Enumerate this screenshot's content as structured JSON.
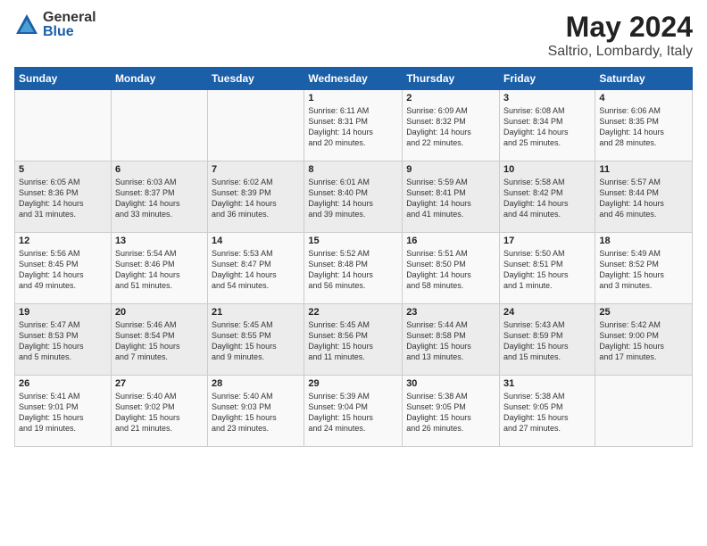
{
  "logo": {
    "general": "General",
    "blue": "Blue"
  },
  "title": "May 2024",
  "subtitle": "Saltrio, Lombardy, Italy",
  "weekdays": [
    "Sunday",
    "Monday",
    "Tuesday",
    "Wednesday",
    "Thursday",
    "Friday",
    "Saturday"
  ],
  "weeks": [
    [
      {
        "day": "",
        "info": ""
      },
      {
        "day": "",
        "info": ""
      },
      {
        "day": "",
        "info": ""
      },
      {
        "day": "1",
        "info": "Sunrise: 6:11 AM\nSunset: 8:31 PM\nDaylight: 14 hours\nand 20 minutes."
      },
      {
        "day": "2",
        "info": "Sunrise: 6:09 AM\nSunset: 8:32 PM\nDaylight: 14 hours\nand 22 minutes."
      },
      {
        "day": "3",
        "info": "Sunrise: 6:08 AM\nSunset: 8:34 PM\nDaylight: 14 hours\nand 25 minutes."
      },
      {
        "day": "4",
        "info": "Sunrise: 6:06 AM\nSunset: 8:35 PM\nDaylight: 14 hours\nand 28 minutes."
      }
    ],
    [
      {
        "day": "5",
        "info": "Sunrise: 6:05 AM\nSunset: 8:36 PM\nDaylight: 14 hours\nand 31 minutes."
      },
      {
        "day": "6",
        "info": "Sunrise: 6:03 AM\nSunset: 8:37 PM\nDaylight: 14 hours\nand 33 minutes."
      },
      {
        "day": "7",
        "info": "Sunrise: 6:02 AM\nSunset: 8:39 PM\nDaylight: 14 hours\nand 36 minutes."
      },
      {
        "day": "8",
        "info": "Sunrise: 6:01 AM\nSunset: 8:40 PM\nDaylight: 14 hours\nand 39 minutes."
      },
      {
        "day": "9",
        "info": "Sunrise: 5:59 AM\nSunset: 8:41 PM\nDaylight: 14 hours\nand 41 minutes."
      },
      {
        "day": "10",
        "info": "Sunrise: 5:58 AM\nSunset: 8:42 PM\nDaylight: 14 hours\nand 44 minutes."
      },
      {
        "day": "11",
        "info": "Sunrise: 5:57 AM\nSunset: 8:44 PM\nDaylight: 14 hours\nand 46 minutes."
      }
    ],
    [
      {
        "day": "12",
        "info": "Sunrise: 5:56 AM\nSunset: 8:45 PM\nDaylight: 14 hours\nand 49 minutes."
      },
      {
        "day": "13",
        "info": "Sunrise: 5:54 AM\nSunset: 8:46 PM\nDaylight: 14 hours\nand 51 minutes."
      },
      {
        "day": "14",
        "info": "Sunrise: 5:53 AM\nSunset: 8:47 PM\nDaylight: 14 hours\nand 54 minutes."
      },
      {
        "day": "15",
        "info": "Sunrise: 5:52 AM\nSunset: 8:48 PM\nDaylight: 14 hours\nand 56 minutes."
      },
      {
        "day": "16",
        "info": "Sunrise: 5:51 AM\nSunset: 8:50 PM\nDaylight: 14 hours\nand 58 minutes."
      },
      {
        "day": "17",
        "info": "Sunrise: 5:50 AM\nSunset: 8:51 PM\nDaylight: 15 hours\nand 1 minute."
      },
      {
        "day": "18",
        "info": "Sunrise: 5:49 AM\nSunset: 8:52 PM\nDaylight: 15 hours\nand 3 minutes."
      }
    ],
    [
      {
        "day": "19",
        "info": "Sunrise: 5:47 AM\nSunset: 8:53 PM\nDaylight: 15 hours\nand 5 minutes."
      },
      {
        "day": "20",
        "info": "Sunrise: 5:46 AM\nSunset: 8:54 PM\nDaylight: 15 hours\nand 7 minutes."
      },
      {
        "day": "21",
        "info": "Sunrise: 5:45 AM\nSunset: 8:55 PM\nDaylight: 15 hours\nand 9 minutes."
      },
      {
        "day": "22",
        "info": "Sunrise: 5:45 AM\nSunset: 8:56 PM\nDaylight: 15 hours\nand 11 minutes."
      },
      {
        "day": "23",
        "info": "Sunrise: 5:44 AM\nSunset: 8:58 PM\nDaylight: 15 hours\nand 13 minutes."
      },
      {
        "day": "24",
        "info": "Sunrise: 5:43 AM\nSunset: 8:59 PM\nDaylight: 15 hours\nand 15 minutes."
      },
      {
        "day": "25",
        "info": "Sunrise: 5:42 AM\nSunset: 9:00 PM\nDaylight: 15 hours\nand 17 minutes."
      }
    ],
    [
      {
        "day": "26",
        "info": "Sunrise: 5:41 AM\nSunset: 9:01 PM\nDaylight: 15 hours\nand 19 minutes."
      },
      {
        "day": "27",
        "info": "Sunrise: 5:40 AM\nSunset: 9:02 PM\nDaylight: 15 hours\nand 21 minutes."
      },
      {
        "day": "28",
        "info": "Sunrise: 5:40 AM\nSunset: 9:03 PM\nDaylight: 15 hours\nand 23 minutes."
      },
      {
        "day": "29",
        "info": "Sunrise: 5:39 AM\nSunset: 9:04 PM\nDaylight: 15 hours\nand 24 minutes."
      },
      {
        "day": "30",
        "info": "Sunrise: 5:38 AM\nSunset: 9:05 PM\nDaylight: 15 hours\nand 26 minutes."
      },
      {
        "day": "31",
        "info": "Sunrise: 5:38 AM\nSunset: 9:05 PM\nDaylight: 15 hours\nand 27 minutes."
      },
      {
        "day": "",
        "info": ""
      }
    ]
  ]
}
